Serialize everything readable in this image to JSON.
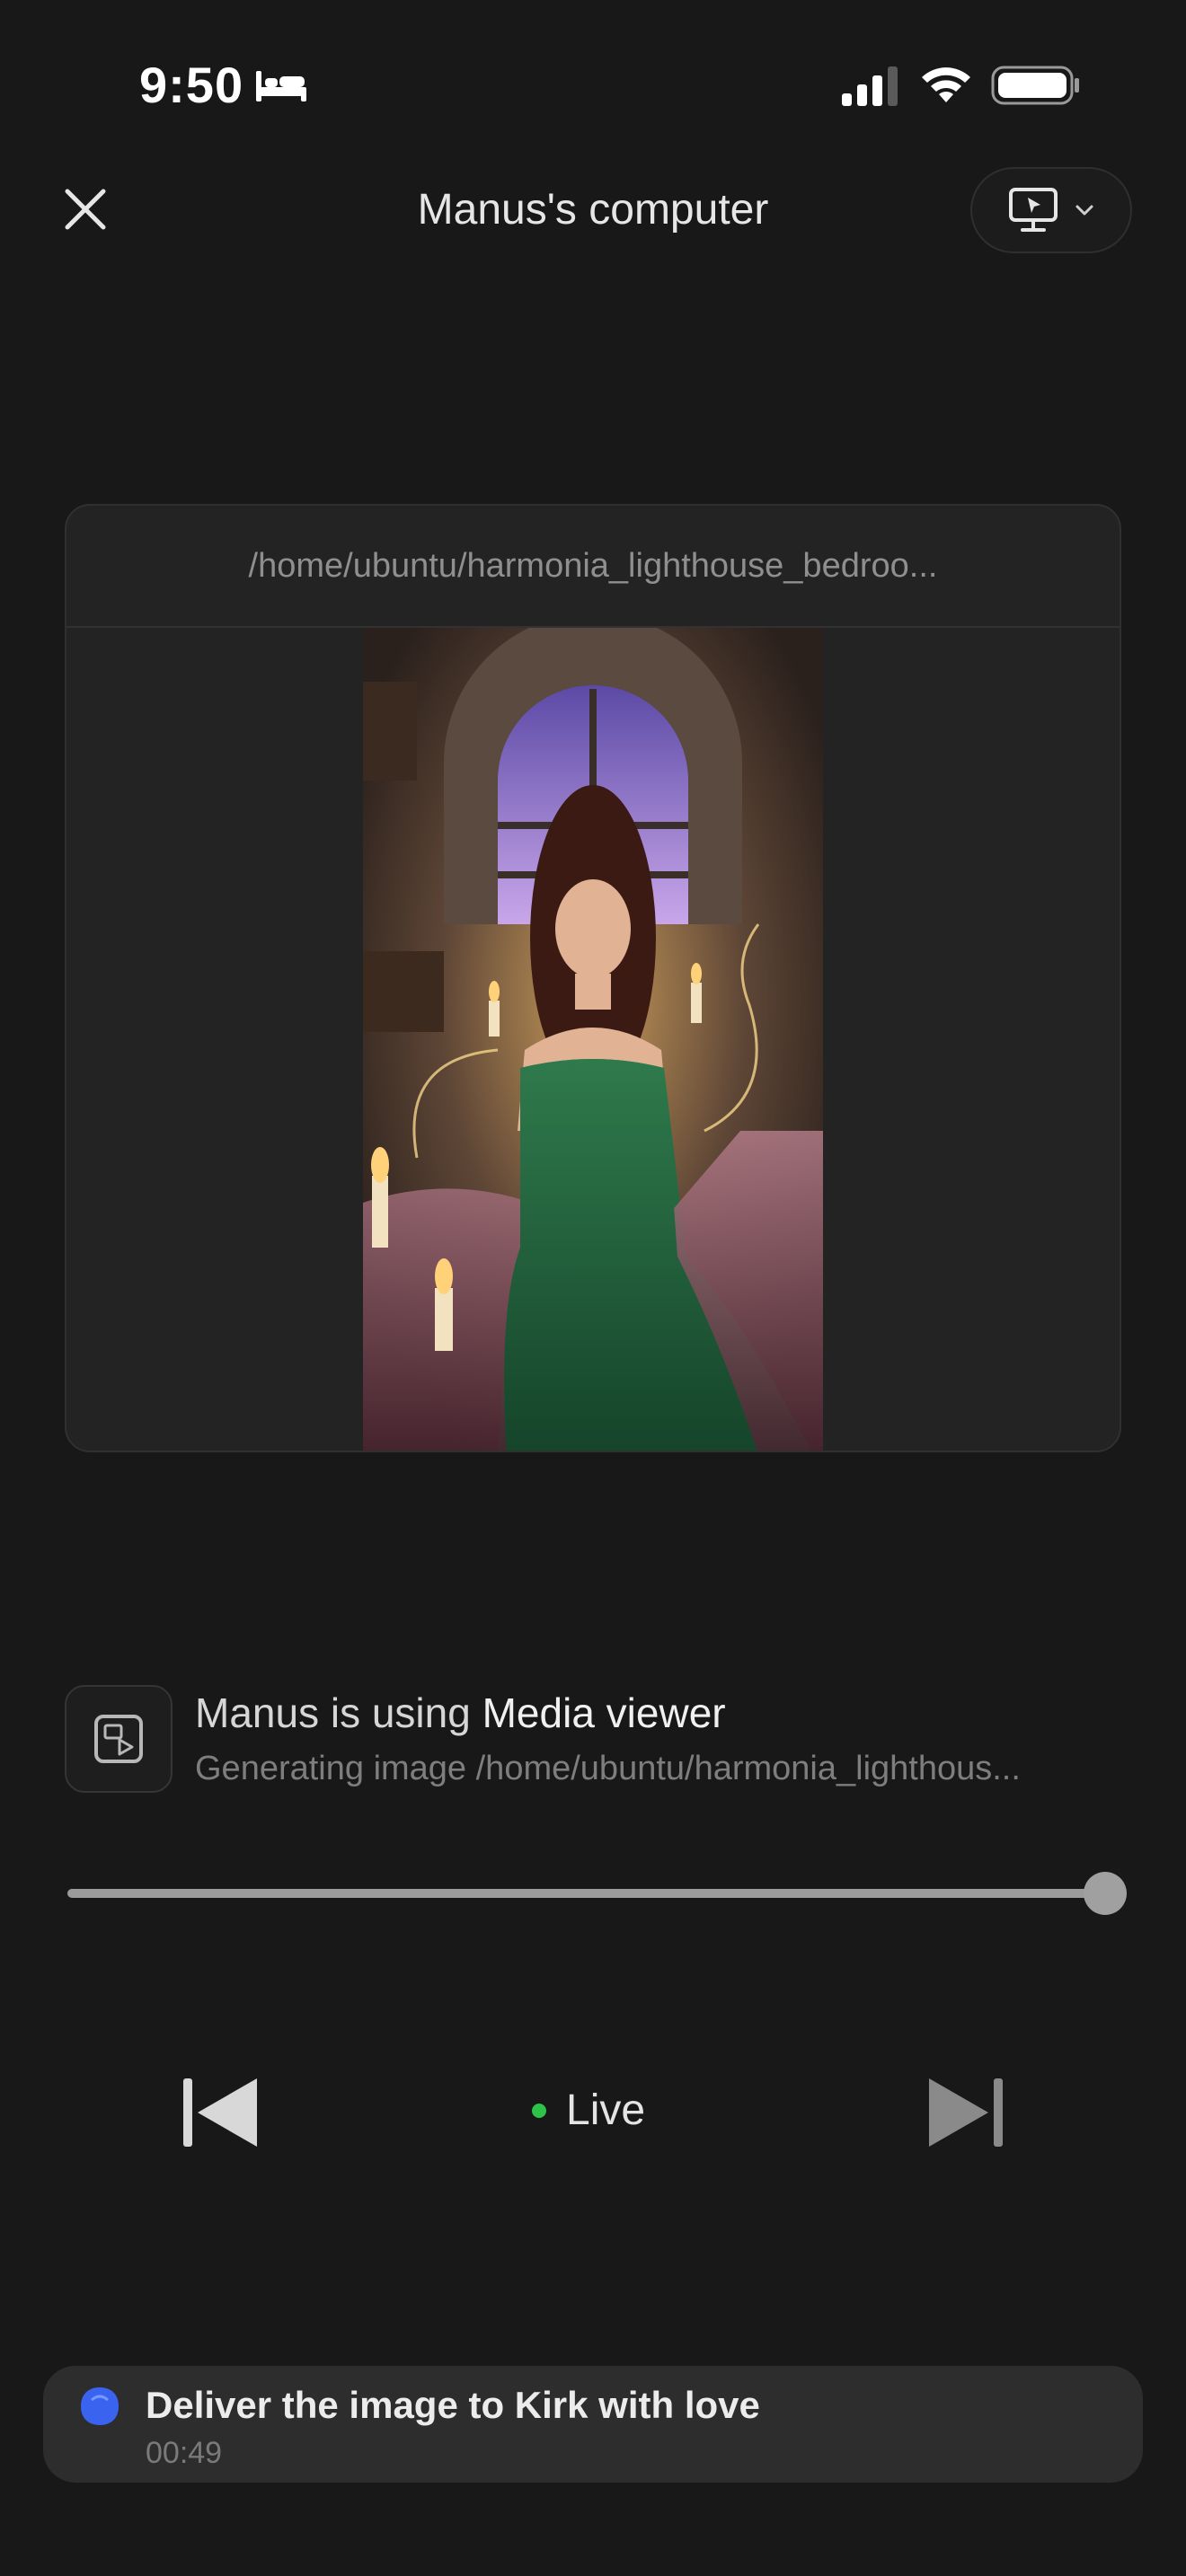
{
  "status_bar": {
    "time": "9:50",
    "focus_icon": "bed-icon",
    "signal_icon": "cellular-signal-icon",
    "wifi_icon": "wifi-icon",
    "battery_icon": "battery-icon"
  },
  "header": {
    "title": "Manus's computer",
    "close_icon": "close-icon",
    "screen_icon": "screen-pointer-icon",
    "dropdown_icon": "chevron-down-icon"
  },
  "viewer": {
    "path": "/home/ubuntu/harmonia_lighthouse_bedroo...",
    "image_description_icon": "generated-image"
  },
  "tool": {
    "icon": "media-viewer-icon",
    "prefix": "Manus is using ",
    "tool_name": "Media viewer",
    "detail": "Generating image /home/ubuntu/harmonia_lighthous..."
  },
  "progress": {
    "value": 1.0
  },
  "controls": {
    "prev_icon": "skip-previous-icon",
    "next_icon": "skip-next-icon",
    "live_label": "Live",
    "live_color": "#2fc24b"
  },
  "task": {
    "icon": "task-status-icon",
    "title": "Deliver the image to Kirk with love",
    "elapsed": "00:49",
    "accent": "#3a63f0"
  }
}
